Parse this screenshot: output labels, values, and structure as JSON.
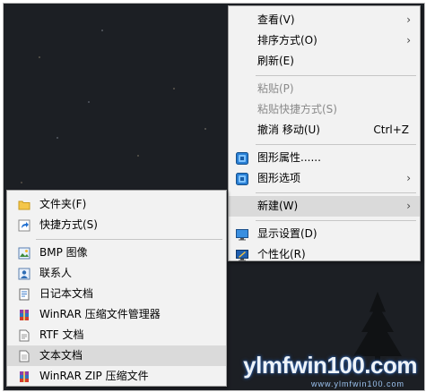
{
  "watermark": {
    "text": "ylmfwin100.com",
    "sub": "www.ylmfwin100.com"
  },
  "context_menu": {
    "items": [
      {
        "label": "查看(V)",
        "has_submenu": true
      },
      {
        "label": "排序方式(O)",
        "has_submenu": true
      },
      {
        "label": "刷新(E)"
      },
      {
        "label": "粘贴(P)",
        "disabled": true
      },
      {
        "label": "粘贴快捷方式(S)",
        "disabled": true
      },
      {
        "label": "撤消 移动(U)",
        "shortcut": "Ctrl+Z"
      },
      {
        "label": "图形属性......",
        "icon": "intel-graphics-icon"
      },
      {
        "label": "图形选项",
        "icon": "intel-graphics-icon",
        "has_submenu": true
      },
      {
        "label": "新建(W)",
        "has_submenu": true,
        "highlighted": true
      },
      {
        "label": "显示设置(D)",
        "icon": "display-icon"
      },
      {
        "label": "个性化(R)",
        "icon": "personalize-icon"
      }
    ]
  },
  "new_submenu": {
    "items": [
      {
        "label": "文件夹(F)",
        "icon": "folder-icon"
      },
      {
        "label": "快捷方式(S)",
        "icon": "shortcut-icon"
      },
      {
        "label": "BMP 图像",
        "icon": "bmp-image-icon"
      },
      {
        "label": "联系人",
        "icon": "contact-icon"
      },
      {
        "label": "日记本文档",
        "icon": "journal-icon"
      },
      {
        "label": "WinRAR 压缩文件管理器",
        "icon": "winrar-icon"
      },
      {
        "label": "RTF 文档",
        "icon": "rtf-document-icon"
      },
      {
        "label": "文本文档",
        "icon": "text-document-icon",
        "highlighted": true
      },
      {
        "label": "WinRAR ZIP 压缩文件",
        "icon": "winrar-zip-icon"
      }
    ]
  },
  "colors": {
    "menu_bg": "#f2f2f2",
    "highlight": "#dadada",
    "disabled_text": "#8a8a8a"
  }
}
